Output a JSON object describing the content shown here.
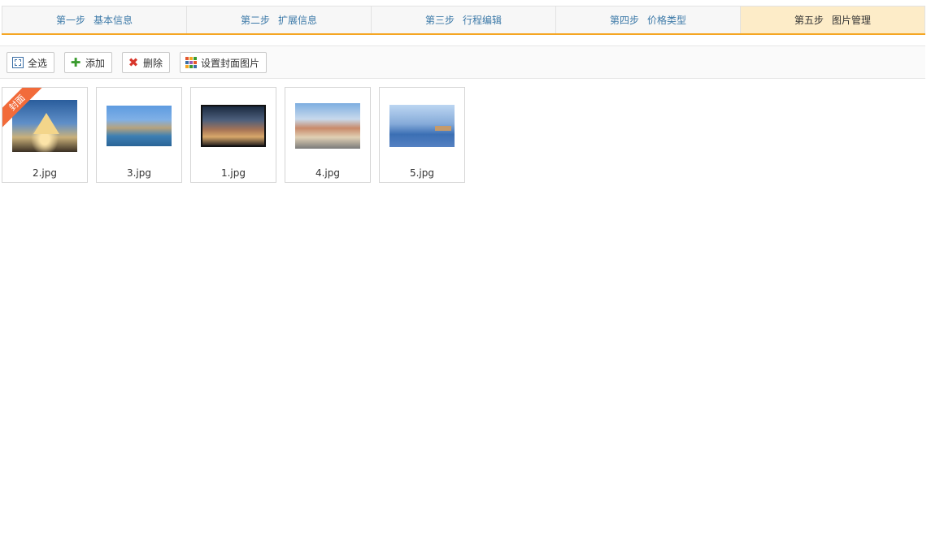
{
  "steps": [
    {
      "num": "第一步",
      "label": "基本信息",
      "active": false
    },
    {
      "num": "第二步",
      "label": "扩展信息",
      "active": false
    },
    {
      "num": "第三步",
      "label": "行程编辑",
      "active": false
    },
    {
      "num": "第四步",
      "label": "价格类型",
      "active": false
    },
    {
      "num": "第五步",
      "label": "图片管理",
      "active": true
    }
  ],
  "toolbar": {
    "select_all": {
      "label": "全选",
      "icon": "select-all-icon"
    },
    "add": {
      "label": "添加",
      "icon": "plus-icon"
    },
    "delete": {
      "label": "删除",
      "icon": "delete-x-icon"
    },
    "set_cover": {
      "label": "设置封面图片",
      "icon": "grid-icon"
    }
  },
  "cover_badge": "封面",
  "images": [
    {
      "filename": "2.jpg",
      "is_cover": true
    },
    {
      "filename": "3.jpg",
      "is_cover": false
    },
    {
      "filename": "1.jpg",
      "is_cover": false
    },
    {
      "filename": "4.jpg",
      "is_cover": false
    },
    {
      "filename": "5.jpg",
      "is_cover": false
    }
  ],
  "colors": {
    "accent": "#f5a623",
    "active_step_bg": "#fdecc8",
    "step_text": "#3c79a8",
    "cover_ribbon": "#f26b3a"
  }
}
